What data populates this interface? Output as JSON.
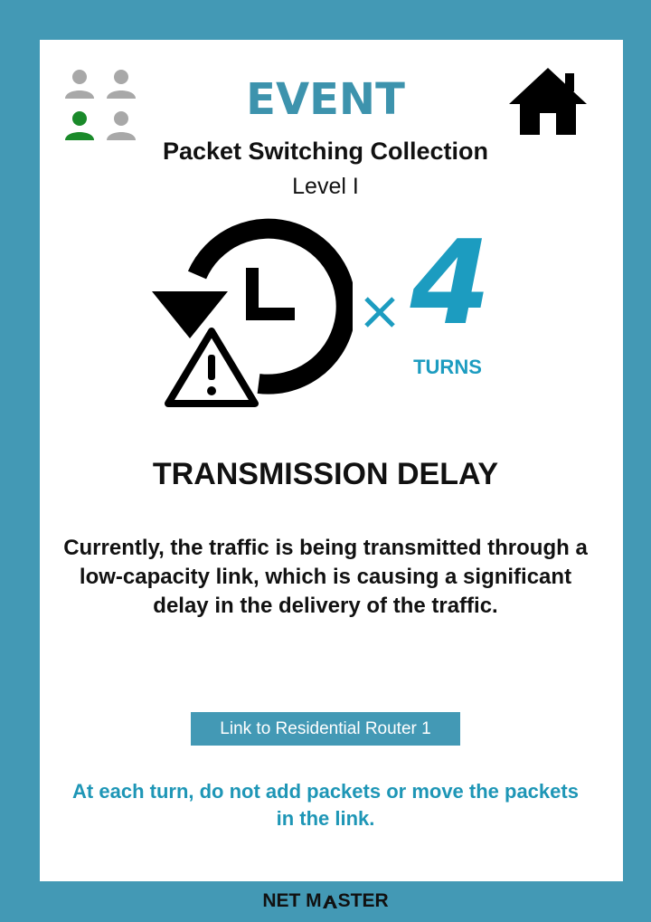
{
  "card": {
    "title": "EVENT",
    "collection": "Packet Switching Collection",
    "level": "Level I",
    "turn_count": "4",
    "turns_label": "TURNS",
    "event_name": "TRANSMISSION DELAY",
    "description": "Currently, the traffic is being transmitted through a low-capacity link, which is causing a significant delay in the delivery of the traffic.",
    "link_button_label": "Link to Residential Router 1",
    "instruction": "At each turn, do not add packets or move the packets in the link."
  },
  "players": [
    {
      "icon": "person-icon",
      "active": false
    },
    {
      "icon": "person-icon",
      "active": false
    },
    {
      "icon": "person-icon",
      "active": true
    },
    {
      "icon": "person-icon",
      "active": false
    }
  ],
  "footer": {
    "logo_left": "NET M",
    "logo_right": "STER"
  },
  "icons": {
    "home": "home-icon",
    "delay": "history-clock-warning-icon",
    "times": "multiply-icon"
  },
  "colors": {
    "frame": "#4399b5",
    "title": "#3d93ad",
    "turns": "#1c9cc0",
    "instruction": "#1e96b6",
    "player_active": "#1a8a2a",
    "player_inactive": "#a8a8a8"
  }
}
